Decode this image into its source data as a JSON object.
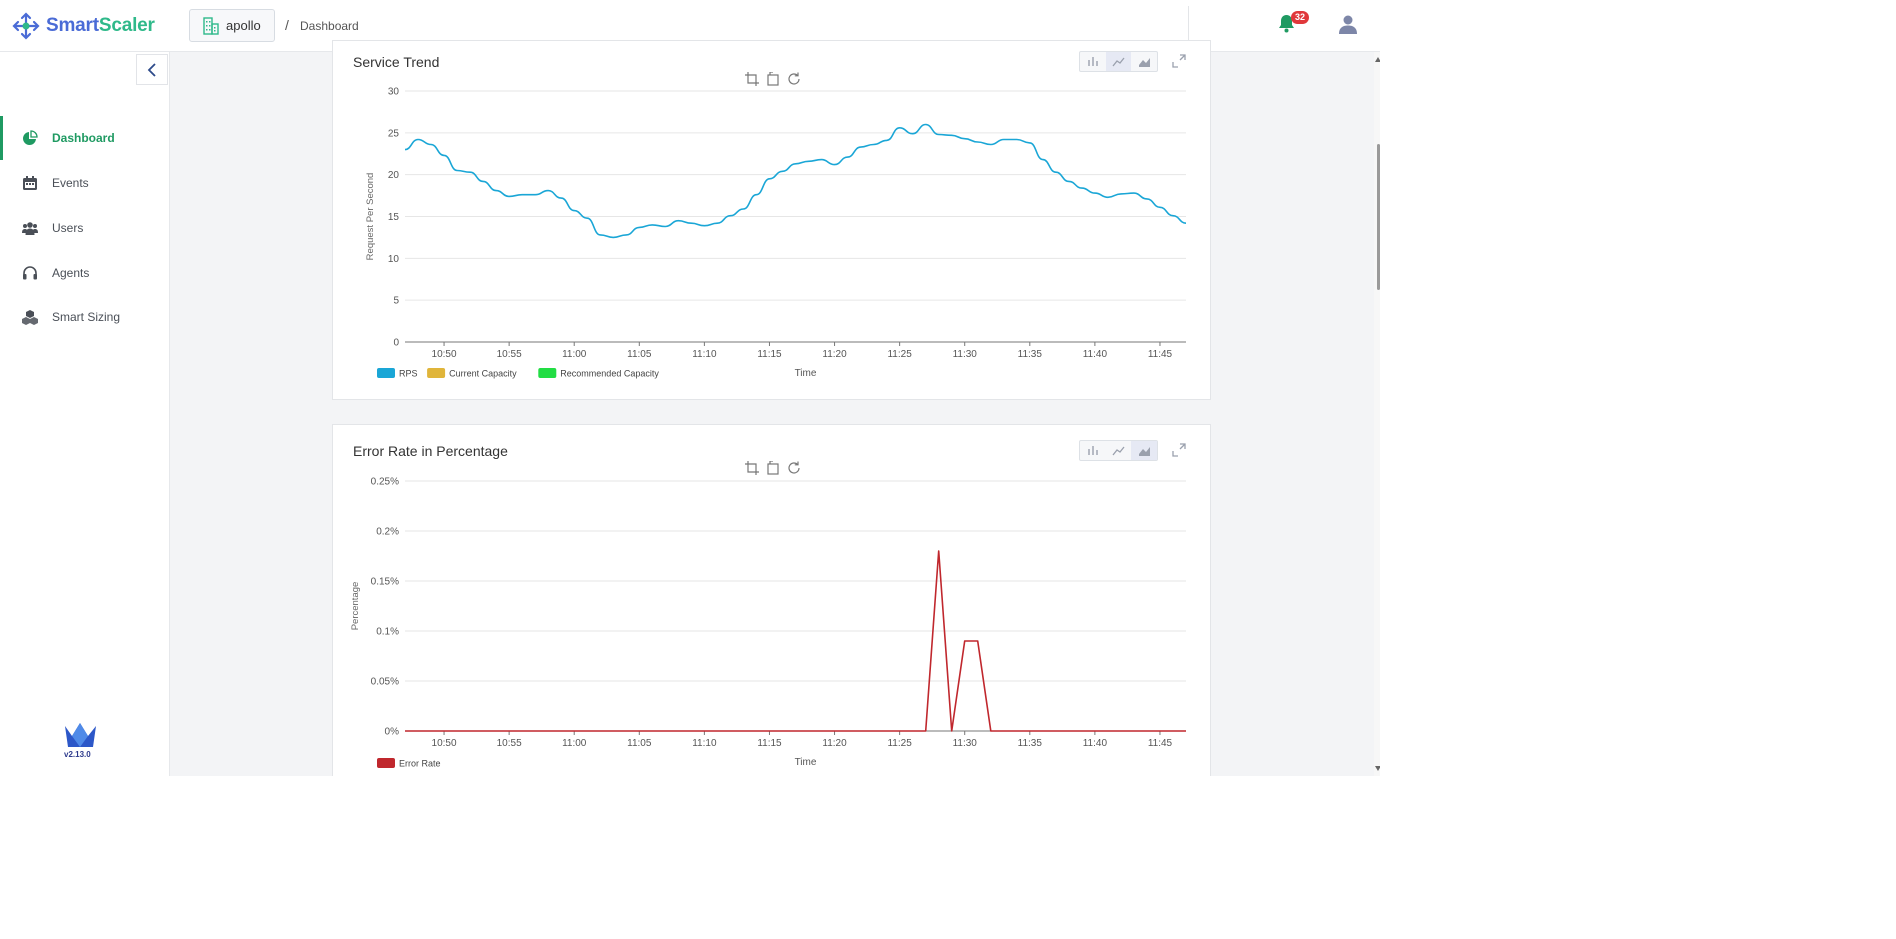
{
  "app": {
    "logo_text_part1": "Smart",
    "logo_text_part2": "Scaler",
    "brand_colors": {
      "blue": "#4a6bd6",
      "green": "#2fb98a"
    }
  },
  "header": {
    "project_name": "apollo",
    "breadcrumb_sep": "/",
    "breadcrumb_page": "Dashboard",
    "notification_count": "32",
    "icons": [
      "building-icon",
      "bell-icon",
      "user-avatar-icon"
    ]
  },
  "sidebar": {
    "items": [
      {
        "label": "Dashboard",
        "icon": "pie-chart-icon",
        "active": true
      },
      {
        "label": "Events",
        "icon": "calendar-icon",
        "active": false
      },
      {
        "label": "Users",
        "icon": "users-icon",
        "active": false
      },
      {
        "label": "Agents",
        "icon": "headset-icon",
        "active": false
      },
      {
        "label": "Smart Sizing",
        "icon": "cubes-icon",
        "active": false
      }
    ],
    "version": "v2.13.0",
    "active_color": "#1f9a62"
  },
  "charts": {
    "service_trend": {
      "title": "Service Trend",
      "ylabel": "Request Per Second",
      "xlabel": "Time",
      "legend": [
        {
          "name": "RPS",
          "color": "#1aa6d6"
        },
        {
          "name": "Current Capacity",
          "color": "#e0b53a"
        },
        {
          "name": "Recommended Capacity",
          "color": "#22dd44"
        }
      ]
    },
    "error_rate": {
      "title": "Error Rate in Percentage",
      "ylabel": "Percentage",
      "xlabel": "Time",
      "legend": [
        {
          "name": "Error Rate",
          "color": "#c0272d"
        }
      ]
    }
  },
  "chart_data": [
    {
      "type": "line",
      "title": "Service Trend",
      "xlabel": "Time",
      "ylabel": "Request Per Second",
      "ylim": [
        0,
        30
      ],
      "yticks": [
        "0",
        "5",
        "10",
        "15",
        "20",
        "25",
        "30"
      ],
      "xticks": [
        "10:50",
        "10:55",
        "11:00",
        "11:05",
        "11:10",
        "11:15",
        "11:20",
        "11:25",
        "11:30",
        "11:35",
        "11:40",
        "11:45"
      ],
      "x_range": [
        "10:47",
        "11:47"
      ],
      "grid": true,
      "legend_position": "bottom-left",
      "series": [
        {
          "name": "RPS",
          "color": "#1aa6d6",
          "x": [
            "10:47",
            "10:48",
            "10:49",
            "10:50",
            "10:51",
            "10:52",
            "10:53",
            "10:54",
            "10:55",
            "10:56",
            "10:57",
            "10:58",
            "10:59",
            "11:00",
            "11:01",
            "11:02",
            "11:03",
            "11:04",
            "11:05",
            "11:06",
            "11:07",
            "11:08",
            "11:09",
            "11:10",
            "11:11",
            "11:12",
            "11:13",
            "11:14",
            "11:15",
            "11:16",
            "11:17",
            "11:18",
            "11:19",
            "11:20",
            "11:21",
            "11:22",
            "11:23",
            "11:24",
            "11:25",
            "11:26",
            "11:27",
            "11:28",
            "11:29",
            "11:30",
            "11:31",
            "11:32",
            "11:33",
            "11:34",
            "11:35",
            "11:36",
            "11:37",
            "11:38",
            "11:39",
            "11:40",
            "11:41",
            "11:42",
            "11:43",
            "11:44",
            "11:45",
            "11:46",
            "11:47"
          ],
          "values": [
            23.0,
            24.2,
            23.6,
            22.3,
            20.5,
            20.3,
            19.2,
            18.1,
            17.4,
            17.6,
            17.6,
            18.1,
            17.2,
            15.7,
            14.8,
            12.8,
            12.5,
            12.8,
            13.7,
            14.0,
            13.8,
            14.5,
            14.2,
            13.9,
            14.2,
            15.1,
            15.9,
            17.6,
            19.5,
            20.4,
            21.3,
            21.6,
            21.8,
            21.2,
            22.1,
            23.3,
            23.6,
            24.1,
            25.6,
            24.9,
            26.0,
            24.8,
            24.7,
            24.3,
            23.9,
            23.6,
            24.2,
            24.2,
            23.8,
            21.8,
            20.3,
            19.2,
            18.4,
            17.8,
            17.3,
            17.7,
            17.8,
            17.1,
            16.1,
            15.1,
            14.2
          ]
        },
        {
          "name": "Current Capacity",
          "color": "#e0b53a",
          "values": []
        },
        {
          "name": "Recommended Capacity",
          "color": "#22dd44",
          "values": []
        }
      ]
    },
    {
      "type": "line",
      "title": "Error Rate in Percentage",
      "xlabel": "Time",
      "ylabel": "Percentage",
      "ylim": [
        0,
        0.25
      ],
      "yticks": [
        "0%",
        "0.05%",
        "0.1%",
        "0.15%",
        "0.2%",
        "0.25%"
      ],
      "xticks": [
        "10:50",
        "10:55",
        "11:00",
        "11:05",
        "11:10",
        "11:15",
        "11:20",
        "11:25",
        "11:30",
        "11:35",
        "11:40",
        "11:45"
      ],
      "x_range": [
        "10:47",
        "11:47"
      ],
      "grid": true,
      "legend_position": "bottom-left",
      "series": [
        {
          "name": "Error Rate",
          "color": "#c0272d",
          "x": [
            "10:47",
            "11:27",
            "11:28",
            "11:29",
            "11:30",
            "11:31",
            "11:32",
            "11:47"
          ],
          "values": [
            0,
            0,
            0.18,
            0,
            0.09,
            0.09,
            0,
            0
          ]
        }
      ]
    }
  ]
}
